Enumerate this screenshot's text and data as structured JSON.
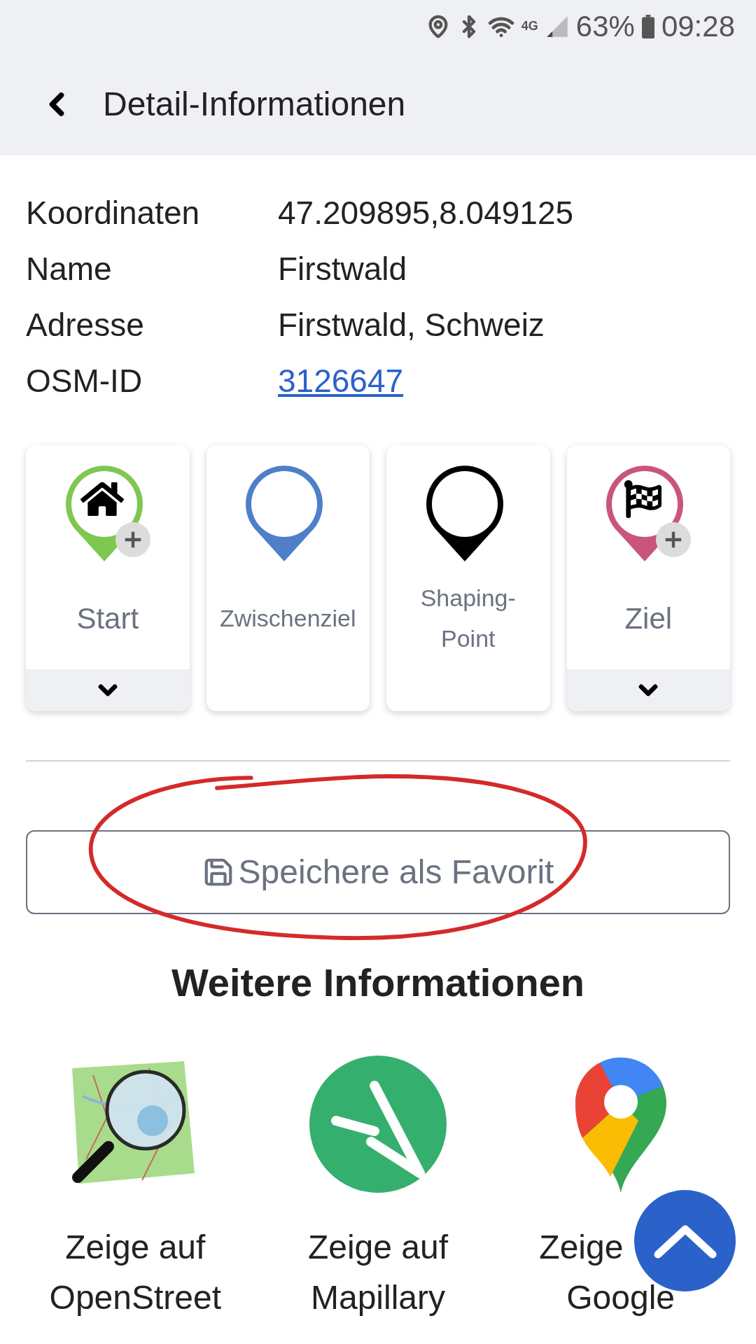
{
  "status_bar": {
    "network": "4G",
    "battery": "63%",
    "time": "09:28"
  },
  "header": {
    "title": "Detail-Informationen"
  },
  "details": [
    {
      "label": "Koordinaten",
      "value": "47.209895,8.049125",
      "kind": "text"
    },
    {
      "label": "Name",
      "value": "Firstwald",
      "kind": "text"
    },
    {
      "label": "Adresse",
      "value": "Firstwald, Schweiz",
      "kind": "text"
    },
    {
      "label": "OSM-ID",
      "value": "3126647",
      "kind": "link"
    }
  ],
  "waypoints": [
    {
      "label": "Start",
      "color": "#7ec850",
      "kind": "home",
      "expandable": true
    },
    {
      "label": "Zwischenziel",
      "color": "#4f7fc9",
      "kind": "empty",
      "expandable": false
    },
    {
      "label": "Shaping-\nPoint",
      "color": "#000000",
      "kind": "empty",
      "expandable": false
    },
    {
      "label": "Ziel",
      "color": "#c9557f",
      "kind": "flag",
      "expandable": true
    }
  ],
  "favorite_button": {
    "label": "Speichere als Favorit"
  },
  "more_info": {
    "title": "Weitere Informationen",
    "links": [
      {
        "kind": "osm",
        "lines": [
          "Zeige auf",
          "OpenStreet"
        ]
      },
      {
        "kind": "mapillary",
        "lines": [
          "Zeige auf",
          "Mapillary"
        ]
      },
      {
        "kind": "google",
        "lines": [
          "Zeige",
          "Google"
        ]
      }
    ]
  }
}
